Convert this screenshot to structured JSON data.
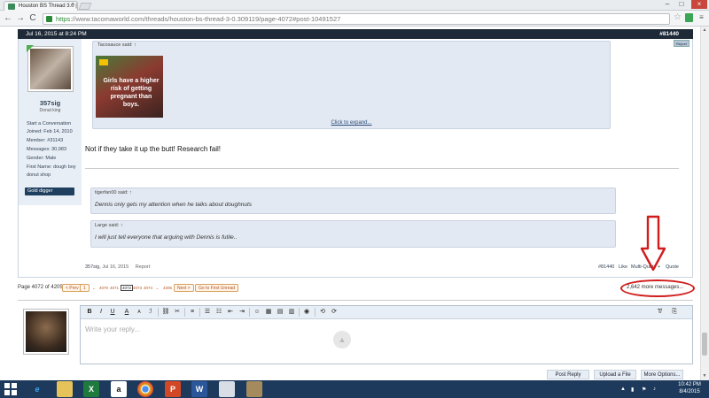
{
  "browser": {
    "tab_title": "Houston BS Thread 3.0 |",
    "tab_close": "×",
    "url_https": "https",
    "url_rest": "://www.tacomaworld.com/threads/houston-bs-thread-3-0.309119/page-4072#post-10491527",
    "back": "←",
    "forward": "→",
    "reload": "C",
    "star": "☆",
    "menu": "≡",
    "minimize": "–",
    "maximize": "□",
    "close": "×"
  },
  "post": {
    "date": "Jul 16, 2015 at 8:24 PM",
    "number": "#81440",
    "report": "Report",
    "user": {
      "name": "357sig",
      "title": "Donut king",
      "stats": [
        "Start a Conversation",
        "Joined: Feb 14, 2010",
        "Member: #31143",
        "Messages: 30,983",
        "Gender: Male",
        "First Name: dough boy",
        "donut shop"
      ],
      "badge": "Gold digger"
    },
    "quote1": {
      "attribution": "Tacosauce said: ↑",
      "image_text": "Girls have a higher risk of getting pregnant than boys.",
      "image_footer": "",
      "expand": "Click to expand..."
    },
    "message": "Not if they take it up the butt! Research fail!",
    "quote2": {
      "attribution": "tigerfan00 said: ↑",
      "text": "Dennis only gets my attention when he talks about doughnuts"
    },
    "quote3": {
      "attribution": "Large said: ↑",
      "text": "I will just tell everyone that arguing with Dennis is futile.."
    },
    "footer": {
      "author": "357sig",
      "date": ", Jul 16, 2015",
      "report": "Report",
      "number": "#81440",
      "like": "Like",
      "multiquote": "Multi-Quote +",
      "quote": "Quote"
    }
  },
  "pagination": {
    "label": "Page 4072 of 4205",
    "prev": "< Prev",
    "first": "1",
    "left_arrow": "←",
    "pages": [
      "4070",
      "4071",
      "4072",
      "4073",
      "4074"
    ],
    "right_arrow": "→",
    "last": "4205",
    "next": "Next >",
    "first_unread": "Go to First Unread",
    "more_messages": "2,642 more messages..."
  },
  "reply": {
    "placeholder": "Write your reply...",
    "up": "▲",
    "toolbar": [
      "B",
      "I",
      "U",
      "A",
      "A",
      "ℐ",
      "⛓",
      "✂",
      "≡",
      "☰",
      "☷",
      "⇤",
      "⇥",
      "☺",
      "▦",
      "▤",
      "▥",
      "◉",
      "⟲",
      "⟳"
    ],
    "clear_format": "T̸",
    "drafts": "⎘",
    "post_reply": "Post Reply",
    "upload": "Upload a File",
    "more_options": "More Options..."
  },
  "taskbar": {
    "time": "10:42 PM",
    "date": "8/4/2015",
    "apps": [
      "e",
      "",
      "X",
      "a",
      "",
      "P",
      "W",
      "",
      ""
    ]
  },
  "colors": {
    "annotation_red": "#d21c1c",
    "post_header": "#1e2a38",
    "taskbar": "#1d3a5c"
  }
}
